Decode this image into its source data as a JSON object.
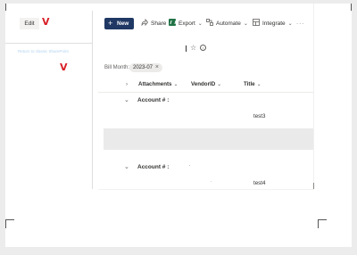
{
  "left_nav": {
    "edit_label": "Edit",
    "return_link": "Return to classic SharePoint",
    "marker_glyph": "V",
    "marker_color": "#d81f26"
  },
  "command_bar": {
    "new_label": "New",
    "share_label": "Share",
    "export_label": "Export",
    "automate_label": "Automate",
    "integrate_label": "Integrate",
    "more_label": "···",
    "accent_color": "#1f3864"
  },
  "list": {
    "title": "",
    "favorite_icon": "star-icon",
    "info_icon": "info-icon"
  },
  "filter": {
    "label": "Bill Month:",
    "value": "2023-07",
    "clear_glyph": "×"
  },
  "columns": [
    {
      "label": "Attachments"
    },
    {
      "label": "VendorID"
    },
    {
      "label": "Title"
    }
  ],
  "groups": [
    {
      "label": "Account # :",
      "rows": [
        {
          "title": "test3"
        }
      ]
    },
    {
      "label": "Account # :",
      "rows": [
        {
          "title": "test4"
        }
      ]
    }
  ]
}
